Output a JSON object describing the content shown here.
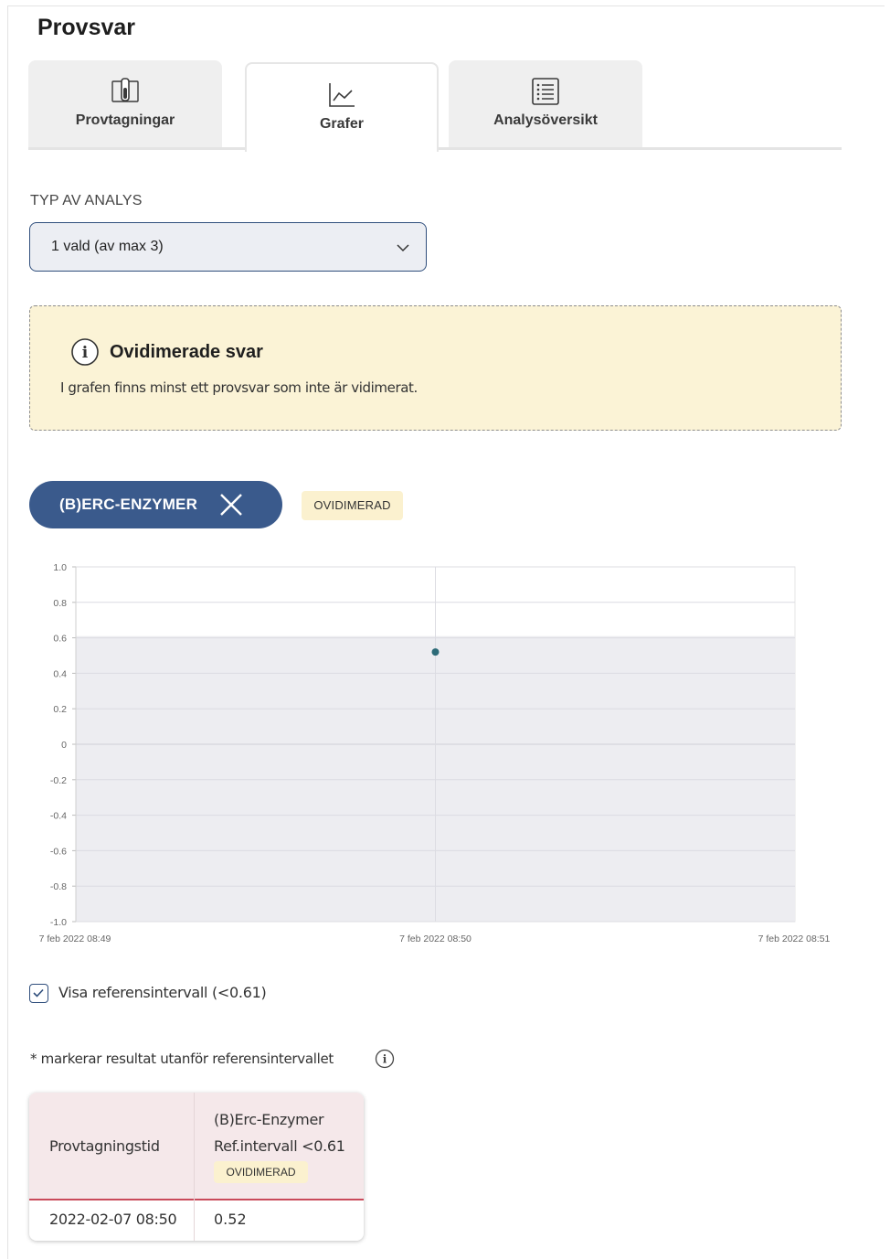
{
  "page": {
    "title": "Provsvar"
  },
  "tabs": [
    {
      "label": "Provtagningar",
      "icon": "test-tube-icon",
      "active": false
    },
    {
      "label": "Grafer",
      "icon": "line-chart-icon",
      "active": true
    },
    {
      "label": "Analysöversikt",
      "icon": "list-icon",
      "active": false
    }
  ],
  "analysis": {
    "label": "TYP AV ANALYS",
    "selected": "1 vald (av max 3)"
  },
  "warning": {
    "title": "Ovidimerade svar",
    "text": "I grafen finns minst ett provsvar som inte är vidimerat."
  },
  "chip": {
    "label": "(B)ERC-ENZYMER",
    "badge": "OVIDIMERAD"
  },
  "chart_data": {
    "type": "scatter",
    "x_ticks": [
      "7 feb 2022 08:49",
      "7 feb 2022 08:50",
      "7 feb 2022 08:51"
    ],
    "y_ticks": [
      "1.0",
      "0.8",
      "0.6",
      "0.4",
      "0.2",
      "0",
      "-0.2",
      "-0.4",
      "-0.6",
      "-0.8",
      "-1.0"
    ],
    "ylim": [
      -1.0,
      1.0
    ],
    "points": [
      {
        "x": "7 feb 2022 08:50",
        "y": 0.52
      }
    ],
    "reference_band": {
      "from": -1.0,
      "to": 0.61
    },
    "point_color": "#2d6b78",
    "band_color": "#ededf1"
  },
  "reference_toggle": {
    "label": "Visa referensintervall (<0.61)",
    "checked": true
  },
  "note": "* markerar resultat utanför referensintervallet",
  "table": {
    "col1_header": "Provtagningstid",
    "col2_header": "(B)Erc-Enzymer",
    "col2_ref": "Ref.intervall <0.61",
    "col2_badge": "OVIDIMERAD",
    "rows": [
      {
        "time": "2022-02-07 08:50",
        "value": "0.52"
      }
    ]
  }
}
